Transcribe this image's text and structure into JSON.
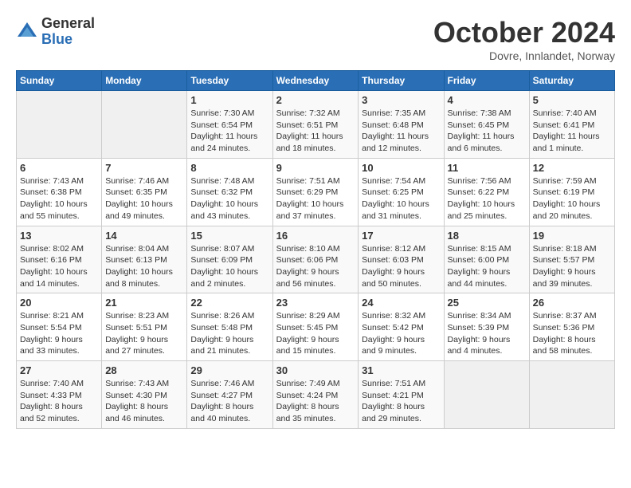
{
  "logo": {
    "general": "General",
    "blue": "Blue"
  },
  "header": {
    "month": "October 2024",
    "location": "Dovre, Innlandet, Norway"
  },
  "weekdays": [
    "Sunday",
    "Monday",
    "Tuesday",
    "Wednesday",
    "Thursday",
    "Friday",
    "Saturday"
  ],
  "weeks": [
    [
      {
        "day": null
      },
      {
        "day": null
      },
      {
        "day": "1",
        "sunrise": "Sunrise: 7:30 AM",
        "sunset": "Sunset: 6:54 PM",
        "daylight": "Daylight: 11 hours and 24 minutes."
      },
      {
        "day": "2",
        "sunrise": "Sunrise: 7:32 AM",
        "sunset": "Sunset: 6:51 PM",
        "daylight": "Daylight: 11 hours and 18 minutes."
      },
      {
        "day": "3",
        "sunrise": "Sunrise: 7:35 AM",
        "sunset": "Sunset: 6:48 PM",
        "daylight": "Daylight: 11 hours and 12 minutes."
      },
      {
        "day": "4",
        "sunrise": "Sunrise: 7:38 AM",
        "sunset": "Sunset: 6:45 PM",
        "daylight": "Daylight: 11 hours and 6 minutes."
      },
      {
        "day": "5",
        "sunrise": "Sunrise: 7:40 AM",
        "sunset": "Sunset: 6:41 PM",
        "daylight": "Daylight: 11 hours and 1 minute."
      }
    ],
    [
      {
        "day": "6",
        "sunrise": "Sunrise: 7:43 AM",
        "sunset": "Sunset: 6:38 PM",
        "daylight": "Daylight: 10 hours and 55 minutes."
      },
      {
        "day": "7",
        "sunrise": "Sunrise: 7:46 AM",
        "sunset": "Sunset: 6:35 PM",
        "daylight": "Daylight: 10 hours and 49 minutes."
      },
      {
        "day": "8",
        "sunrise": "Sunrise: 7:48 AM",
        "sunset": "Sunset: 6:32 PM",
        "daylight": "Daylight: 10 hours and 43 minutes."
      },
      {
        "day": "9",
        "sunrise": "Sunrise: 7:51 AM",
        "sunset": "Sunset: 6:29 PM",
        "daylight": "Daylight: 10 hours and 37 minutes."
      },
      {
        "day": "10",
        "sunrise": "Sunrise: 7:54 AM",
        "sunset": "Sunset: 6:25 PM",
        "daylight": "Daylight: 10 hours and 31 minutes."
      },
      {
        "day": "11",
        "sunrise": "Sunrise: 7:56 AM",
        "sunset": "Sunset: 6:22 PM",
        "daylight": "Daylight: 10 hours and 25 minutes."
      },
      {
        "day": "12",
        "sunrise": "Sunrise: 7:59 AM",
        "sunset": "Sunset: 6:19 PM",
        "daylight": "Daylight: 10 hours and 20 minutes."
      }
    ],
    [
      {
        "day": "13",
        "sunrise": "Sunrise: 8:02 AM",
        "sunset": "Sunset: 6:16 PM",
        "daylight": "Daylight: 10 hours and 14 minutes."
      },
      {
        "day": "14",
        "sunrise": "Sunrise: 8:04 AM",
        "sunset": "Sunset: 6:13 PM",
        "daylight": "Daylight: 10 hours and 8 minutes."
      },
      {
        "day": "15",
        "sunrise": "Sunrise: 8:07 AM",
        "sunset": "Sunset: 6:09 PM",
        "daylight": "Daylight: 10 hours and 2 minutes."
      },
      {
        "day": "16",
        "sunrise": "Sunrise: 8:10 AM",
        "sunset": "Sunset: 6:06 PM",
        "daylight": "Daylight: 9 hours and 56 minutes."
      },
      {
        "day": "17",
        "sunrise": "Sunrise: 8:12 AM",
        "sunset": "Sunset: 6:03 PM",
        "daylight": "Daylight: 9 hours and 50 minutes."
      },
      {
        "day": "18",
        "sunrise": "Sunrise: 8:15 AM",
        "sunset": "Sunset: 6:00 PM",
        "daylight": "Daylight: 9 hours and 44 minutes."
      },
      {
        "day": "19",
        "sunrise": "Sunrise: 8:18 AM",
        "sunset": "Sunset: 5:57 PM",
        "daylight": "Daylight: 9 hours and 39 minutes."
      }
    ],
    [
      {
        "day": "20",
        "sunrise": "Sunrise: 8:21 AM",
        "sunset": "Sunset: 5:54 PM",
        "daylight": "Daylight: 9 hours and 33 minutes."
      },
      {
        "day": "21",
        "sunrise": "Sunrise: 8:23 AM",
        "sunset": "Sunset: 5:51 PM",
        "daylight": "Daylight: 9 hours and 27 minutes."
      },
      {
        "day": "22",
        "sunrise": "Sunrise: 8:26 AM",
        "sunset": "Sunset: 5:48 PM",
        "daylight": "Daylight: 9 hours and 21 minutes."
      },
      {
        "day": "23",
        "sunrise": "Sunrise: 8:29 AM",
        "sunset": "Sunset: 5:45 PM",
        "daylight": "Daylight: 9 hours and 15 minutes."
      },
      {
        "day": "24",
        "sunrise": "Sunrise: 8:32 AM",
        "sunset": "Sunset: 5:42 PM",
        "daylight": "Daylight: 9 hours and 9 minutes."
      },
      {
        "day": "25",
        "sunrise": "Sunrise: 8:34 AM",
        "sunset": "Sunset: 5:39 PM",
        "daylight": "Daylight: 9 hours and 4 minutes."
      },
      {
        "day": "26",
        "sunrise": "Sunrise: 8:37 AM",
        "sunset": "Sunset: 5:36 PM",
        "daylight": "Daylight: 8 hours and 58 minutes."
      }
    ],
    [
      {
        "day": "27",
        "sunrise": "Sunrise: 7:40 AM",
        "sunset": "Sunset: 4:33 PM",
        "daylight": "Daylight: 8 hours and 52 minutes."
      },
      {
        "day": "28",
        "sunrise": "Sunrise: 7:43 AM",
        "sunset": "Sunset: 4:30 PM",
        "daylight": "Daylight: 8 hours and 46 minutes."
      },
      {
        "day": "29",
        "sunrise": "Sunrise: 7:46 AM",
        "sunset": "Sunset: 4:27 PM",
        "daylight": "Daylight: 8 hours and 40 minutes."
      },
      {
        "day": "30",
        "sunrise": "Sunrise: 7:49 AM",
        "sunset": "Sunset: 4:24 PM",
        "daylight": "Daylight: 8 hours and 35 minutes."
      },
      {
        "day": "31",
        "sunrise": "Sunrise: 7:51 AM",
        "sunset": "Sunset: 4:21 PM",
        "daylight": "Daylight: 8 hours and 29 minutes."
      },
      {
        "day": null
      },
      {
        "day": null
      }
    ]
  ]
}
